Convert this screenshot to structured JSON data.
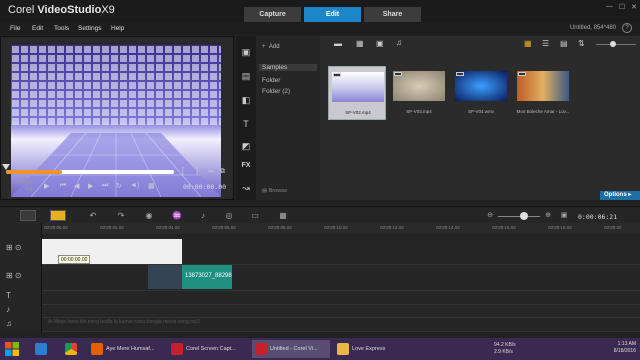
{
  "app": {
    "logo_brand": "Corel",
    "logo_product": "VideoStudio",
    "logo_version": "X9",
    "project_info": "Untitled, 854*480"
  },
  "tabs": [
    {
      "label": "Capture"
    },
    {
      "label": "Edit"
    },
    {
      "label": "Share"
    }
  ],
  "menu": [
    "File",
    "Edit",
    "Tools",
    "Settings",
    "Help"
  ],
  "player": {
    "project_label": "Project",
    "clip_label": "Clip",
    "timecode": "00:00:00.00",
    "zoom_pct": "33"
  },
  "library": {
    "add_label": "Add",
    "folders": [
      "Samples",
      "Folder",
      "Folder (2)"
    ],
    "browse_label": "Browse",
    "options_label": "Options"
  },
  "thumbs": [
    {
      "caption": "SP-V02.mp4"
    },
    {
      "caption": "SP-V03.mp4"
    },
    {
      "caption": "SP-V04.wmv"
    },
    {
      "caption": "Mon Boleche Amar - Lov..."
    }
  ],
  "timeline": {
    "timecode": "0:00:06:21",
    "ruler": [
      "00:00:00.00",
      "00:00:02.00",
      "00:00:04.00",
      "00:00:06.00",
      "00:00:08.00",
      "00:00:10.00",
      "00:00:12.00",
      "00:00:14.00",
      "00:00:16.00",
      "00:00:18.00",
      "00:00:20"
    ],
    "clip_tooltip": "00:00:00.00",
    "overlay_clip": "13873027_88298",
    "music_text": "Ai Meye kono din nong bodle ty kumar sanu bangla movie song.mp3"
  },
  "taskbar": {
    "items": [
      "Aye Mere Humsaf...",
      "Corel Screen Capt...",
      "Untitled - Corel Vi...",
      "Love Express"
    ],
    "net_up": "94.2 KB/s",
    "net_down": "2.9 KB/s",
    "time": "1:13 AM",
    "date": "8/18/2016"
  },
  "colors": {
    "accent": "#1d86c8",
    "timeline_clip": "#1f8f82",
    "tab_active": "#1d86c8"
  }
}
